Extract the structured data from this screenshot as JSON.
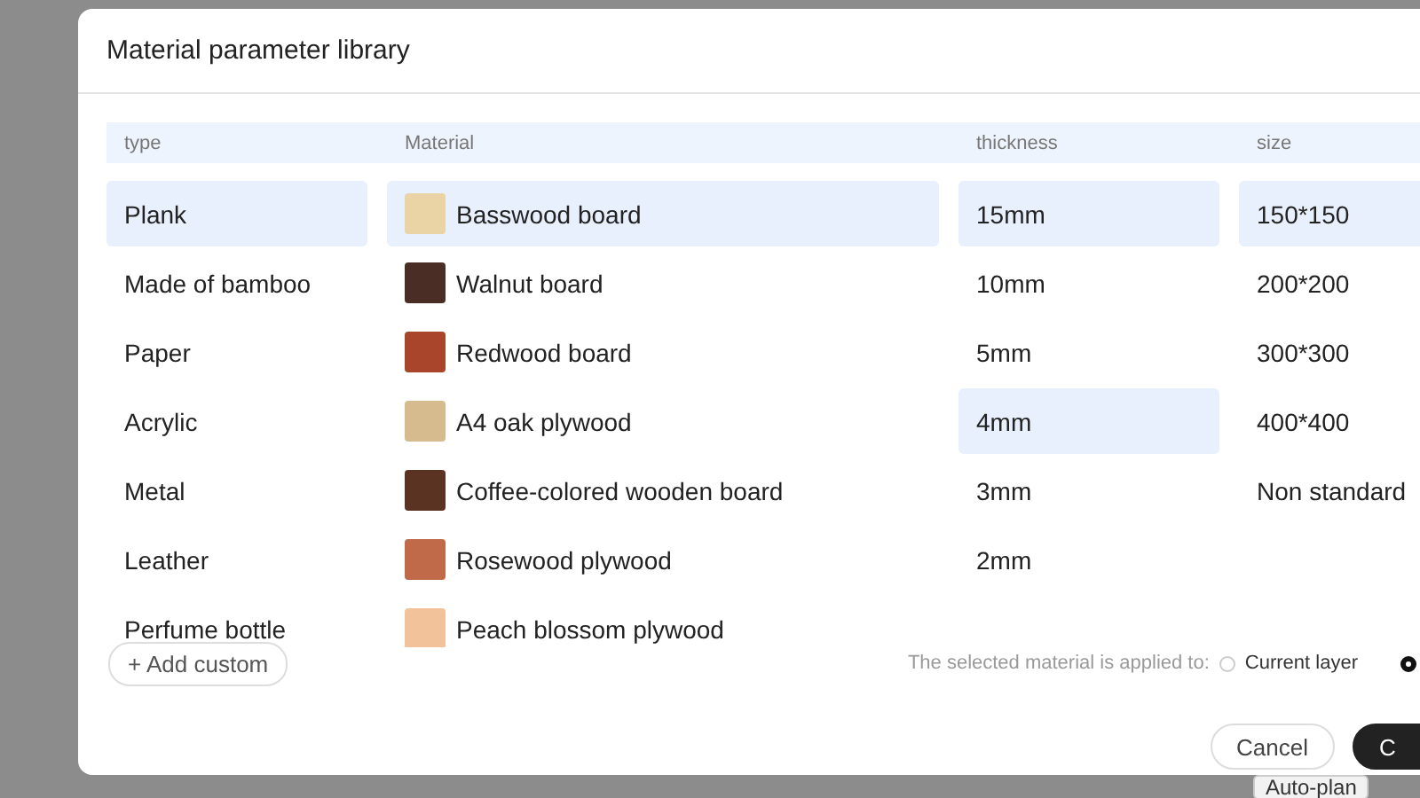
{
  "background": {
    "button": "Auto-plan"
  },
  "dialog": {
    "title": "Material parameter library",
    "columns": [
      "type",
      "Material",
      "thickness",
      "size"
    ],
    "types": [
      {
        "label": "Plank",
        "selected": true
      },
      {
        "label": "Made of bamboo",
        "selected": false
      },
      {
        "label": "Paper",
        "selected": false
      },
      {
        "label": "Acrylic",
        "selected": false
      },
      {
        "label": "Metal",
        "selected": false
      },
      {
        "label": "Leather",
        "selected": false
      },
      {
        "label": "Perfume bottle",
        "selected": false
      }
    ],
    "materials": [
      {
        "label": "Basswood board",
        "color": "#ead3a4",
        "selected": true
      },
      {
        "label": "Walnut board",
        "color": "#4a2e25",
        "selected": false
      },
      {
        "label": "Redwood board",
        "color": "#a8452a",
        "selected": false
      },
      {
        "label": "A4 oak plywood",
        "color": "#d6bb8e",
        "selected": false
      },
      {
        "label": "Coffee-colored wooden board",
        "color": "#5a3322",
        "selected": false
      },
      {
        "label": "Rosewood plywood",
        "color": "#c06a4a",
        "selected": false
      },
      {
        "label": "Peach blossom plywood",
        "color": "#f2c29a",
        "selected": false
      }
    ],
    "thicknesses": [
      {
        "label": "15mm",
        "selected": true
      },
      {
        "label": "10mm",
        "selected": false
      },
      {
        "label": "5mm",
        "selected": false
      },
      {
        "label": "4mm",
        "selected": true
      },
      {
        "label": "3mm",
        "selected": false
      },
      {
        "label": "2mm",
        "selected": false
      }
    ],
    "sizes": [
      {
        "label": "150*150",
        "selected": true
      },
      {
        "label": "200*200",
        "selected": false
      },
      {
        "label": "300*300",
        "selected": false
      },
      {
        "label": "400*400",
        "selected": false
      },
      {
        "label": "Non standard",
        "selected": false
      }
    ],
    "add_button": "+ Add custom",
    "apply": {
      "label": "The selected material is applied to:",
      "options": [
        {
          "label": "Current layer",
          "selected": false
        },
        {
          "selected": true
        }
      ]
    },
    "buttons": [
      {
        "label": "Cancel",
        "kind": "secondary"
      },
      {
        "label": "C",
        "kind": "primary"
      }
    ]
  }
}
